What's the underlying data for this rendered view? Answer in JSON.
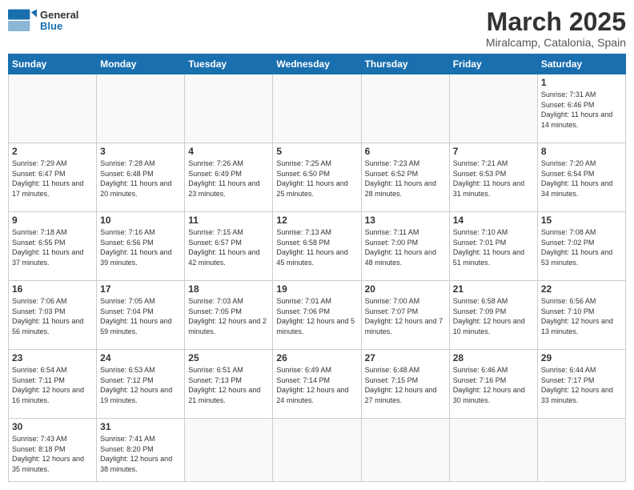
{
  "logo": {
    "text_general": "General",
    "text_blue": "Blue"
  },
  "title": "March 2025",
  "subtitle": "Miralcamp, Catalonia, Spain",
  "days_of_week": [
    "Sunday",
    "Monday",
    "Tuesday",
    "Wednesday",
    "Thursday",
    "Friday",
    "Saturday"
  ],
  "weeks": [
    [
      null,
      null,
      null,
      null,
      null,
      null,
      {
        "day": 1,
        "sunrise": "7:31 AM",
        "sunset": "6:46 PM",
        "daylight": "11 hours and 14 minutes."
      }
    ],
    [
      {
        "day": 2,
        "sunrise": "7:29 AM",
        "sunset": "6:47 PM",
        "daylight": "11 hours and 17 minutes."
      },
      {
        "day": 3,
        "sunrise": "7:28 AM",
        "sunset": "6:48 PM",
        "daylight": "11 hours and 20 minutes."
      },
      {
        "day": 4,
        "sunrise": "7:26 AM",
        "sunset": "6:49 PM",
        "daylight": "11 hours and 23 minutes."
      },
      {
        "day": 5,
        "sunrise": "7:25 AM",
        "sunset": "6:50 PM",
        "daylight": "11 hours and 25 minutes."
      },
      {
        "day": 6,
        "sunrise": "7:23 AM",
        "sunset": "6:52 PM",
        "daylight": "11 hours and 28 minutes."
      },
      {
        "day": 7,
        "sunrise": "7:21 AM",
        "sunset": "6:53 PM",
        "daylight": "11 hours and 31 minutes."
      },
      {
        "day": 8,
        "sunrise": "7:20 AM",
        "sunset": "6:54 PM",
        "daylight": "11 hours and 34 minutes."
      }
    ],
    [
      {
        "day": 9,
        "sunrise": "7:18 AM",
        "sunset": "6:55 PM",
        "daylight": "11 hours and 37 minutes."
      },
      {
        "day": 10,
        "sunrise": "7:16 AM",
        "sunset": "6:56 PM",
        "daylight": "11 hours and 39 minutes."
      },
      {
        "day": 11,
        "sunrise": "7:15 AM",
        "sunset": "6:57 PM",
        "daylight": "11 hours and 42 minutes."
      },
      {
        "day": 12,
        "sunrise": "7:13 AM",
        "sunset": "6:58 PM",
        "daylight": "11 hours and 45 minutes."
      },
      {
        "day": 13,
        "sunrise": "7:11 AM",
        "sunset": "7:00 PM",
        "daylight": "11 hours and 48 minutes."
      },
      {
        "day": 14,
        "sunrise": "7:10 AM",
        "sunset": "7:01 PM",
        "daylight": "11 hours and 51 minutes."
      },
      {
        "day": 15,
        "sunrise": "7:08 AM",
        "sunset": "7:02 PM",
        "daylight": "11 hours and 53 minutes."
      }
    ],
    [
      {
        "day": 16,
        "sunrise": "7:06 AM",
        "sunset": "7:03 PM",
        "daylight": "11 hours and 56 minutes."
      },
      {
        "day": 17,
        "sunrise": "7:05 AM",
        "sunset": "7:04 PM",
        "daylight": "11 hours and 59 minutes."
      },
      {
        "day": 18,
        "sunrise": "7:03 AM",
        "sunset": "7:05 PM",
        "daylight": "12 hours and 2 minutes."
      },
      {
        "day": 19,
        "sunrise": "7:01 AM",
        "sunset": "7:06 PM",
        "daylight": "12 hours and 5 minutes."
      },
      {
        "day": 20,
        "sunrise": "7:00 AM",
        "sunset": "7:07 PM",
        "daylight": "12 hours and 7 minutes."
      },
      {
        "day": 21,
        "sunrise": "6:58 AM",
        "sunset": "7:09 PM",
        "daylight": "12 hours and 10 minutes."
      },
      {
        "day": 22,
        "sunrise": "6:56 AM",
        "sunset": "7:10 PM",
        "daylight": "12 hours and 13 minutes."
      }
    ],
    [
      {
        "day": 23,
        "sunrise": "6:54 AM",
        "sunset": "7:11 PM",
        "daylight": "12 hours and 16 minutes."
      },
      {
        "day": 24,
        "sunrise": "6:53 AM",
        "sunset": "7:12 PM",
        "daylight": "12 hours and 19 minutes."
      },
      {
        "day": 25,
        "sunrise": "6:51 AM",
        "sunset": "7:13 PM",
        "daylight": "12 hours and 21 minutes."
      },
      {
        "day": 26,
        "sunrise": "6:49 AM",
        "sunset": "7:14 PM",
        "daylight": "12 hours and 24 minutes."
      },
      {
        "day": 27,
        "sunrise": "6:48 AM",
        "sunset": "7:15 PM",
        "daylight": "12 hours and 27 minutes."
      },
      {
        "day": 28,
        "sunrise": "6:46 AM",
        "sunset": "7:16 PM",
        "daylight": "12 hours and 30 minutes."
      },
      {
        "day": 29,
        "sunrise": "6:44 AM",
        "sunset": "7:17 PM",
        "daylight": "12 hours and 33 minutes."
      }
    ],
    [
      {
        "day": 30,
        "sunrise": "7:43 AM",
        "sunset": "8:18 PM",
        "daylight": "12 hours and 35 minutes."
      },
      {
        "day": 31,
        "sunrise": "7:41 AM",
        "sunset": "8:20 PM",
        "daylight": "12 hours and 38 minutes."
      },
      null,
      null,
      null,
      null,
      null
    ]
  ]
}
